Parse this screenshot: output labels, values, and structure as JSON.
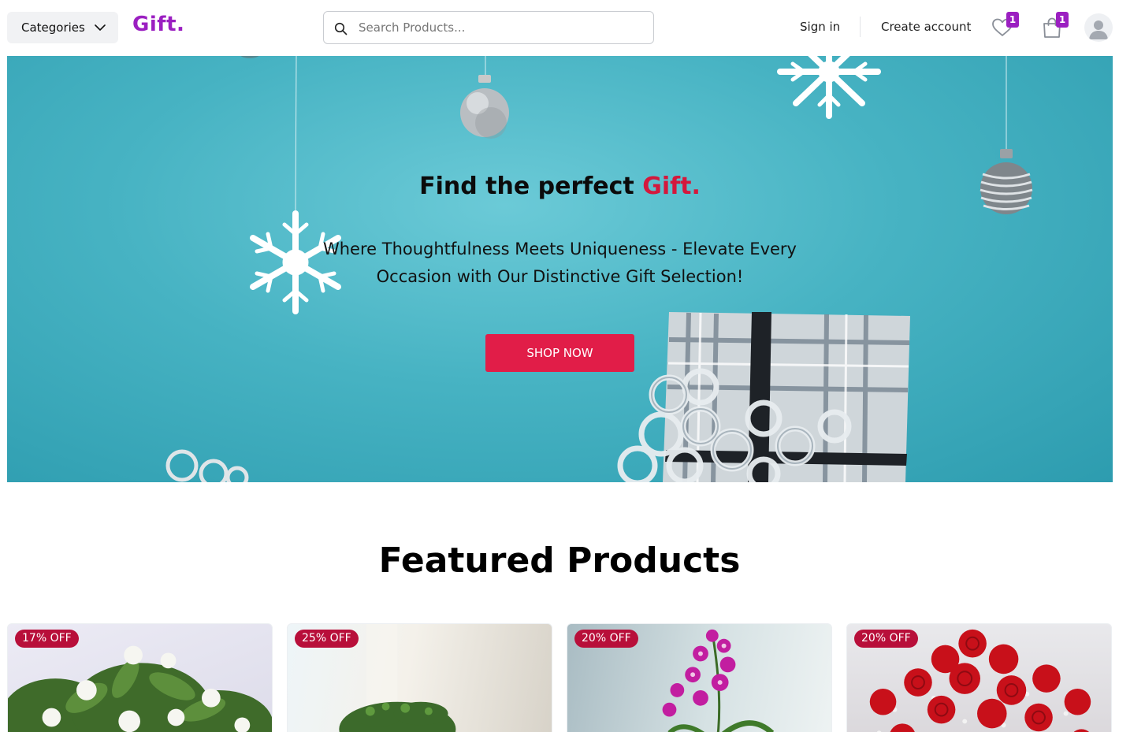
{
  "header": {
    "categories_label": "Categories",
    "logo": "Gift.",
    "search_placeholder": "Search Products...",
    "sign_in": "Sign in",
    "create_account": "Create account",
    "wishlist_count": "1",
    "cart_count": "1",
    "brand_color": "#9b1fc1"
  },
  "hero": {
    "title_prefix": "Find the perfect ",
    "title_accent": "Gift.",
    "subtitle": "Where Thoughtfulness Meets Uniqueness - Elevate Every Occasion with Our Distinctive Gift Selection!",
    "cta": "SHOP NOW",
    "accent_color": "#d4183c",
    "cta_color": "#e11d48"
  },
  "featured": {
    "title": "Featured Products",
    "products": [
      {
        "discount": "17% OFF"
      },
      {
        "discount": "25% OFF"
      },
      {
        "discount": "20% OFF"
      },
      {
        "discount": "20% OFF"
      }
    ]
  }
}
